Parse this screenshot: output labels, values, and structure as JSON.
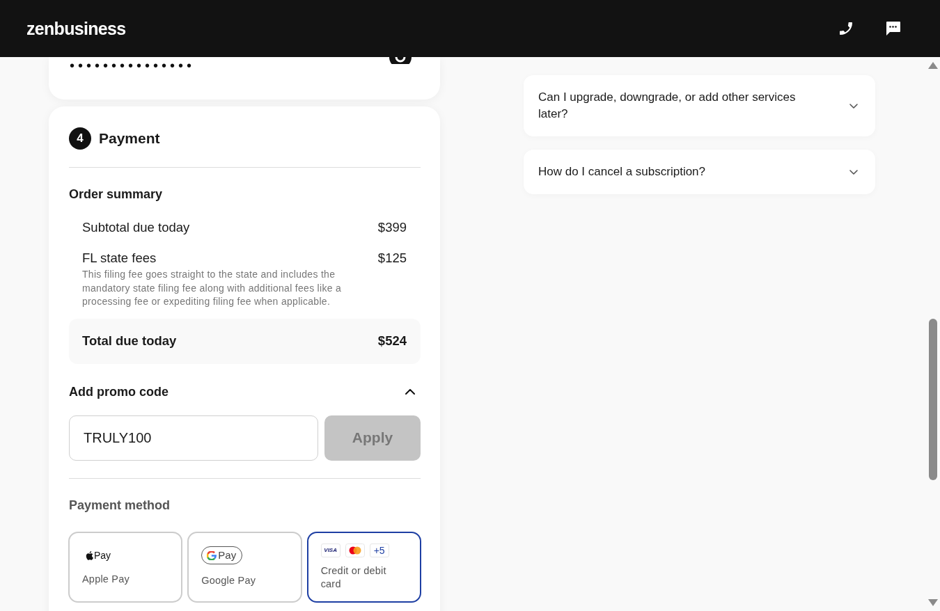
{
  "header": {
    "logo": "zenbusiness"
  },
  "account": {
    "password": "•••••••••••••••"
  },
  "payment": {
    "step": "4",
    "title": "Payment",
    "order_summary": {
      "title": "Order summary",
      "lines": [
        {
          "label": "Subtotal due today",
          "amount": "$399"
        },
        {
          "label": "FL state fees",
          "amount": "$125",
          "description": "This filing fee goes straight to the state and includes the mandatory state filing fee along with additional fees like a processing fee or expediting filing fee when applicable."
        }
      ],
      "total": {
        "label": "Total due today",
        "amount": "$524"
      }
    },
    "promo": {
      "title": "Add promo code",
      "expanded": true,
      "value": "TRULY100",
      "button": {
        "label": "Apply",
        "disabled": true
      }
    },
    "payment_method": {
      "title": "Payment method",
      "options": [
        {
          "kind": "apple",
          "logo_text": "Pay",
          "label": "Apple Pay",
          "selected": false
        },
        {
          "kind": "google",
          "logo_text": "Pay",
          "label": "Google Pay",
          "selected": false
        },
        {
          "kind": "card",
          "brands": [
            {
              "kind": "visa",
              "text": "VISA"
            },
            {
              "kind": "mastercard"
            },
            {
              "kind": "more",
              "text": "+5"
            }
          ],
          "label": "Credit or debit card",
          "selected": true
        }
      ]
    }
  },
  "faq": [
    {
      "question": "Can I upgrade, downgrade, or add other services later?",
      "expanded": false
    },
    {
      "question": "How do I cancel a subscription?",
      "expanded": false
    }
  ]
}
